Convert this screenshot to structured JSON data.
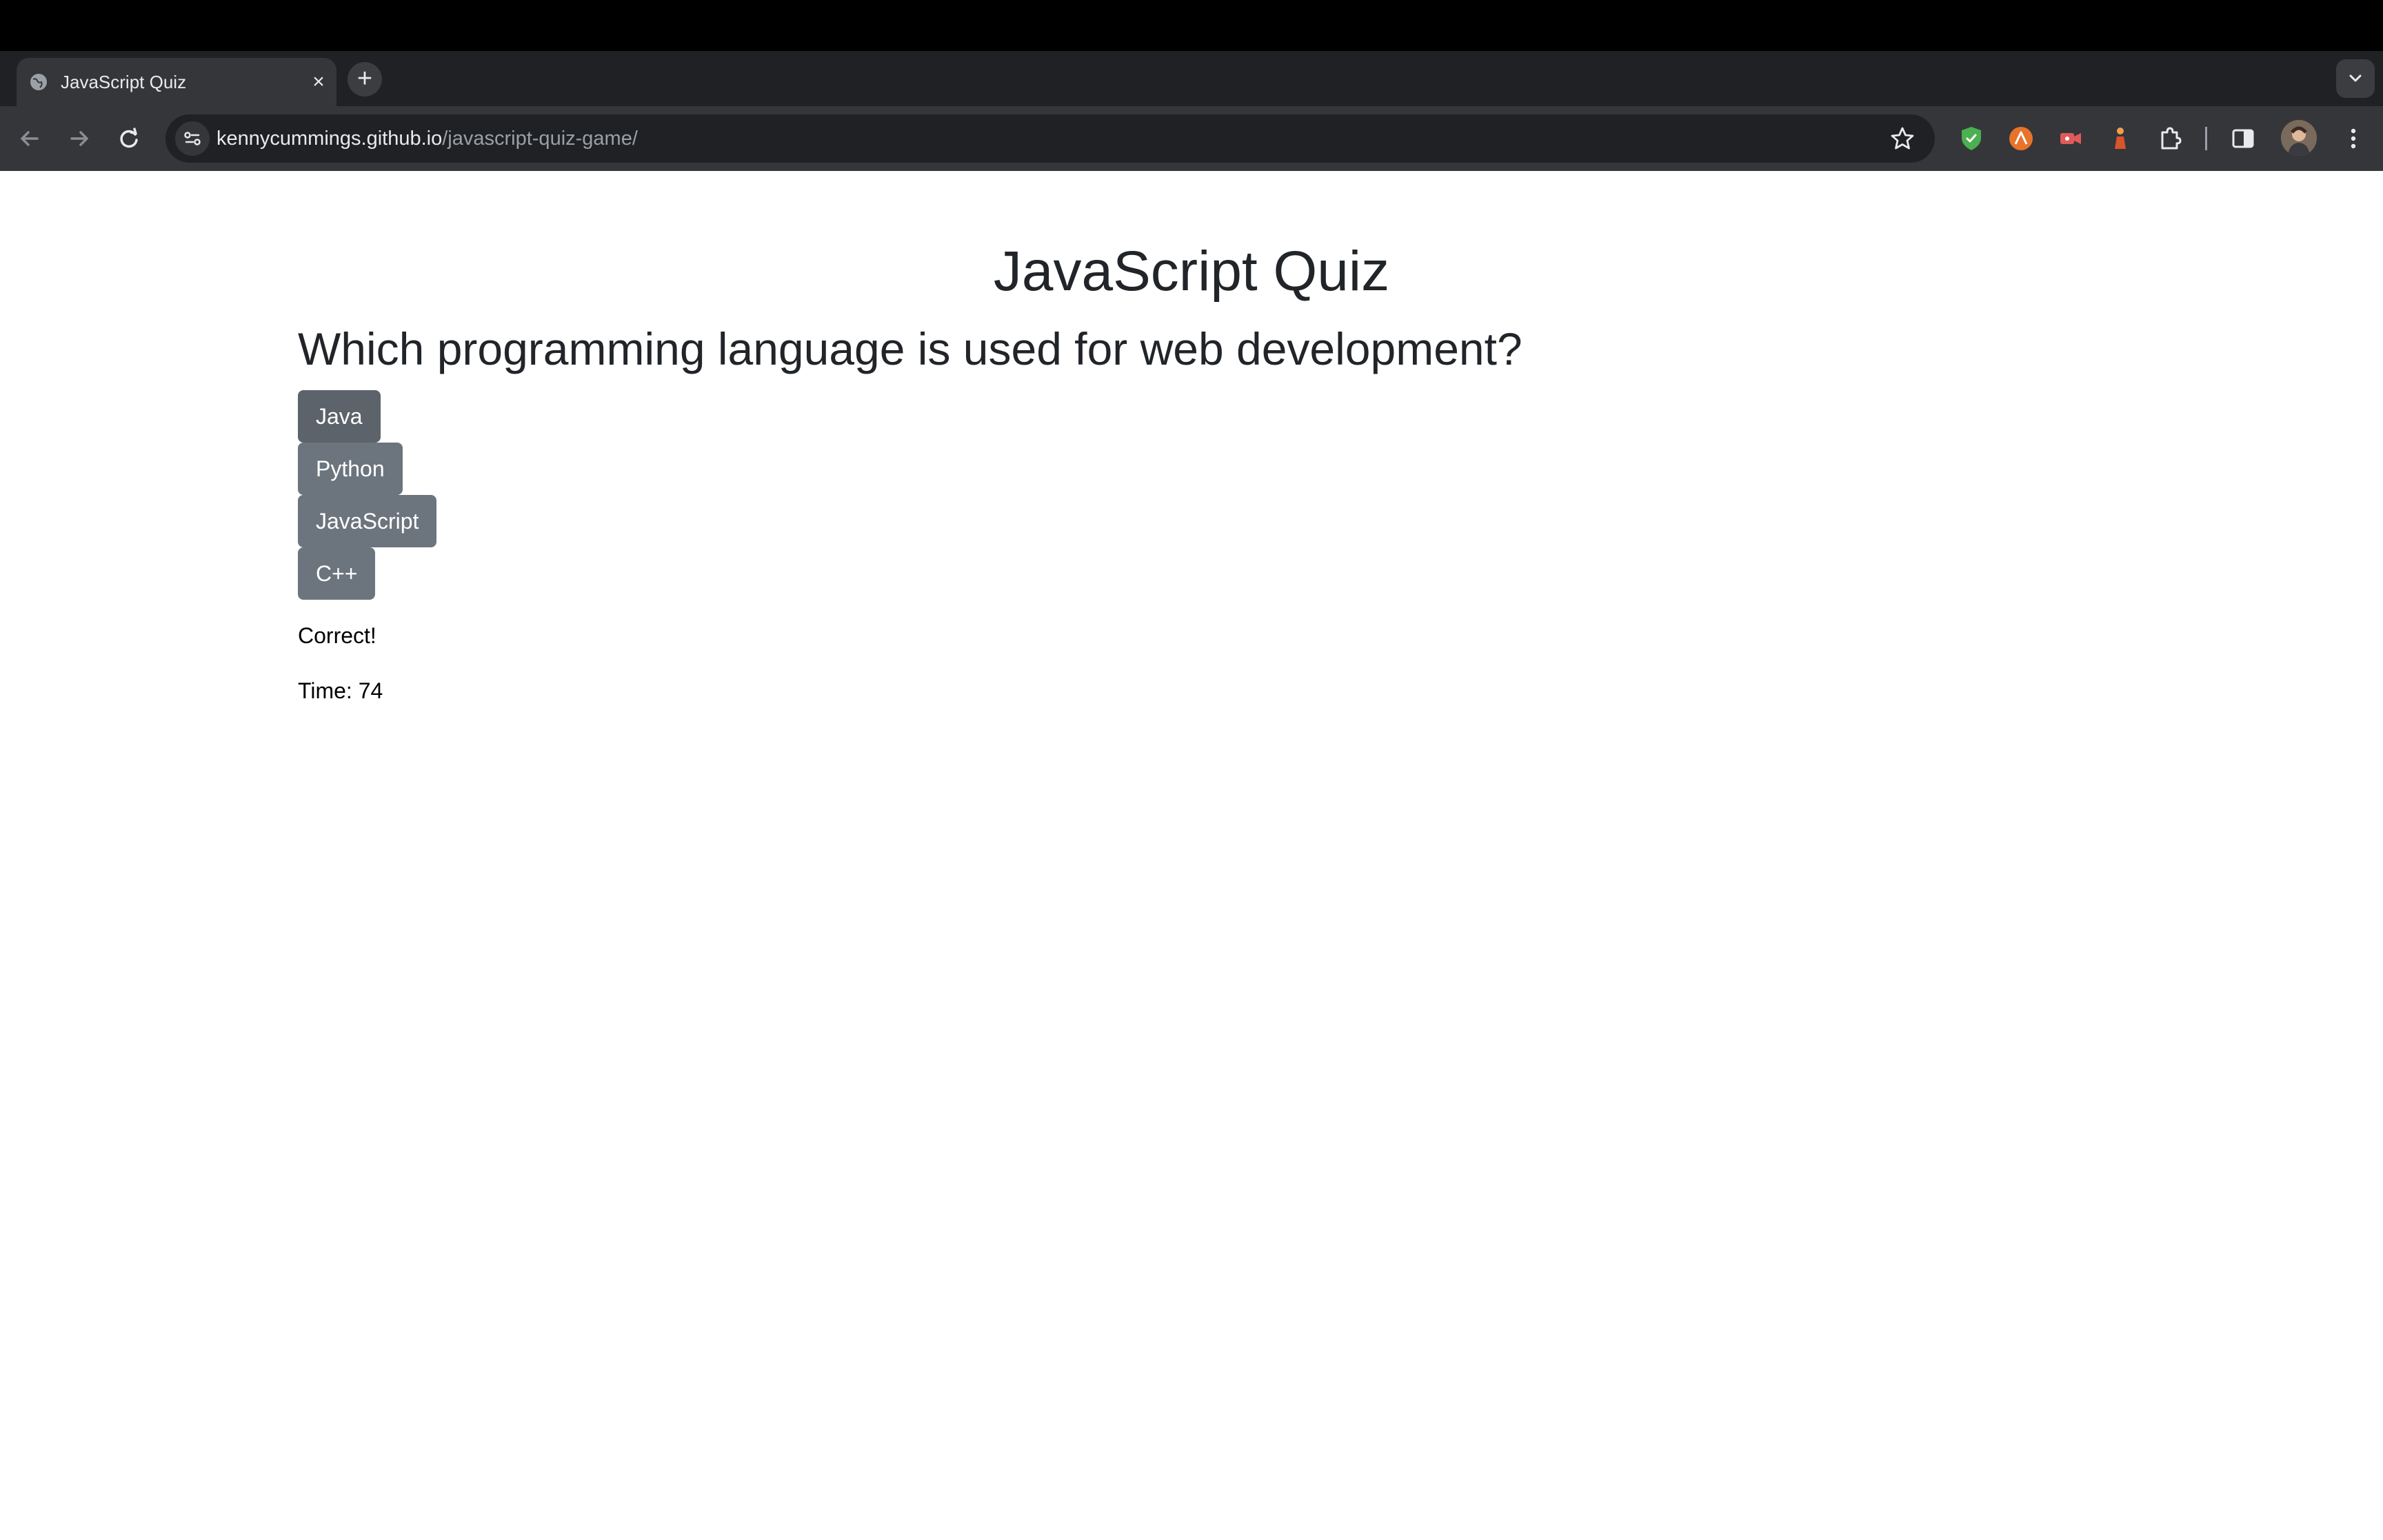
{
  "browser": {
    "tab": {
      "title": "JavaScript Quiz",
      "close_glyph": "×"
    },
    "new_tab_glyph": "+",
    "address": {
      "host": "kennycummings.github.io",
      "path": "/javascript-quiz-game/"
    },
    "icons": [
      "back-icon",
      "forward-icon",
      "reload-icon",
      "site-info-icon",
      "bookmark-star-icon",
      "shield-extension-icon",
      "orange-extension-icon",
      "video-extension-icon",
      "figure-extension-icon",
      "puzzle-extensions-icon",
      "side-panel-icon",
      "profile-avatar",
      "kebab-menu-icon"
    ],
    "colors": {
      "tabstrip": "#202124",
      "toolbar": "#35363a",
      "omnibox": "#202124"
    }
  },
  "quiz": {
    "title": "JavaScript Quiz",
    "question": "Which programming language is used for web development?",
    "answers": [
      {
        "label": "Java"
      },
      {
        "label": "Python"
      },
      {
        "label": "JavaScript"
      },
      {
        "label": "C++"
      }
    ],
    "feedback": "Correct!",
    "timer_label": "Time: 74",
    "colors": {
      "button": "#6c757d",
      "button_hover": "#5c636a",
      "text": "#212529"
    }
  }
}
